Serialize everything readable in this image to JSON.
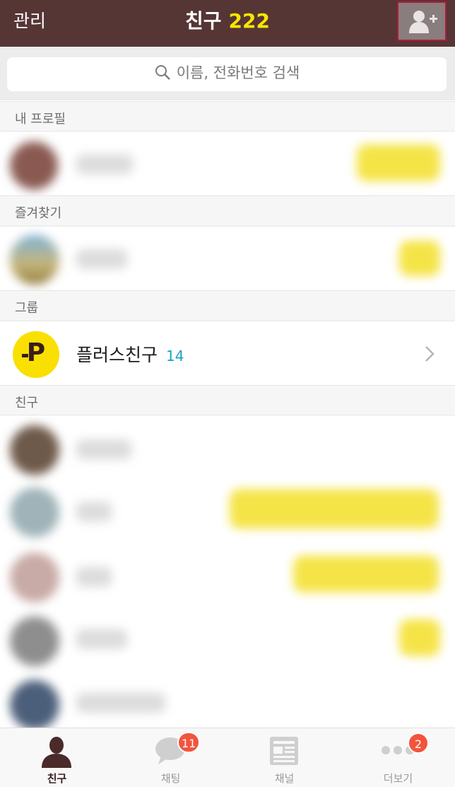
{
  "header": {
    "manage_label": "관리",
    "title": "친구",
    "friend_count": "222",
    "add_friend_icon": "person-add-icon"
  },
  "search": {
    "placeholder": "이름, 전화번호 검색",
    "icon": "search-icon"
  },
  "sections": {
    "my_profile": "내 프로필",
    "favorites": "즐겨찾기",
    "groups": "그룹",
    "friends": "친구"
  },
  "plus_friend": {
    "label": "플러스친구",
    "count": "14",
    "logo_letter": "P"
  },
  "tabs": [
    {
      "label": "친구",
      "icon": "person-icon",
      "active": true
    },
    {
      "label": "채팅",
      "icon": "chat-bubble-icon",
      "badge": "11"
    },
    {
      "label": "채널",
      "icon": "news-icon"
    },
    {
      "label": "더보기",
      "icon": "more-dots-icon",
      "badge": "2"
    }
  ],
  "colors": {
    "header_bg": "#563535",
    "accent_yellow": "#f7e600",
    "badge_red": "#f2543d",
    "plus_count": "#1aa3c0"
  }
}
